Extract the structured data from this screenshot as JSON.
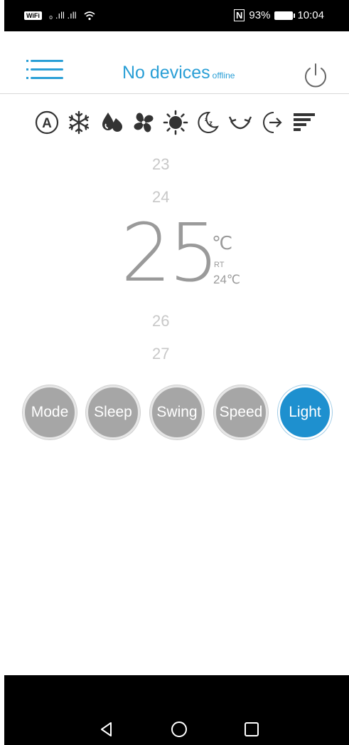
{
  "status_bar": {
    "wifi_badge": "WiFi",
    "left_text": "₀ .ıll .ıll",
    "nfc": "N",
    "battery": "93%",
    "time": "10:04"
  },
  "header": {
    "title": "No devices",
    "subtitle": "offline"
  },
  "modes": [
    {
      "icon": "auto-mode-icon"
    },
    {
      "icon": "cool-snowflake-icon"
    },
    {
      "icon": "dry-drops-icon"
    },
    {
      "icon": "fan-icon"
    },
    {
      "icon": "heat-sun-icon"
    },
    {
      "icon": "sleep-moon-icon"
    },
    {
      "icon": "swing-icon"
    },
    {
      "icon": "eco-icon"
    },
    {
      "icon": "fan-speed-icon"
    }
  ],
  "temperature": {
    "above2": "23",
    "above1": "24",
    "current": "25",
    "unit": "℃",
    "rt_label": "RT",
    "rt_value": "24℃",
    "below1": "26",
    "below2": "27"
  },
  "buttons": [
    {
      "label": "Mode",
      "active": false
    },
    {
      "label": "Sleep",
      "active": false
    },
    {
      "label": "Swing",
      "active": false
    },
    {
      "label": "Speed",
      "active": false
    },
    {
      "label": "Light",
      "active": true
    }
  ],
  "colors": {
    "accent": "#2a9fd6",
    "button_grey": "#a6a6a6",
    "button_active": "#1e90cf",
    "temp_grey": "#9a9a9a"
  }
}
